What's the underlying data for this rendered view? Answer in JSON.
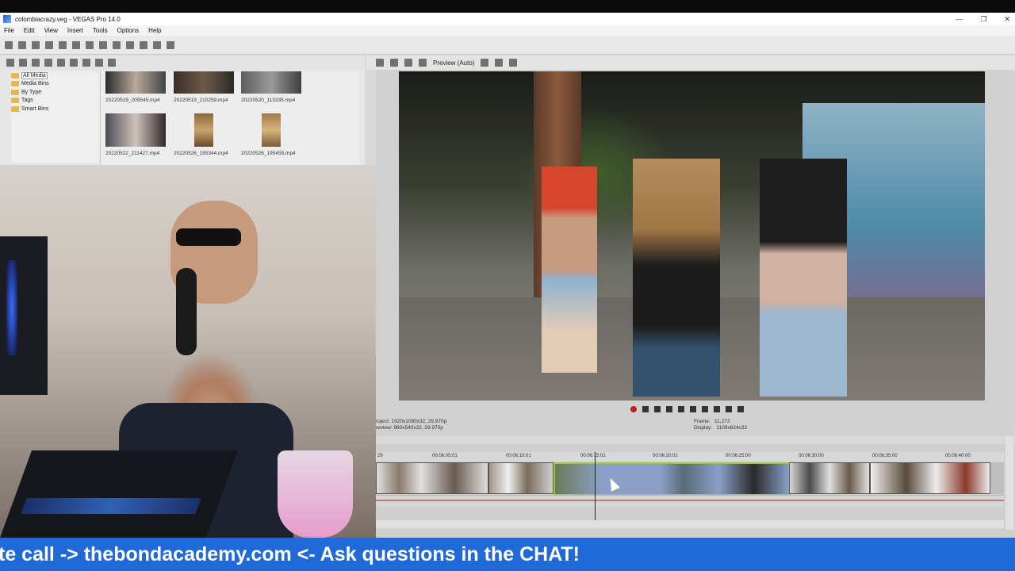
{
  "window": {
    "title": "colombiacrazy.veg - VEGAS Pro 14.0",
    "controls": [
      "—",
      "❐",
      "✕"
    ]
  },
  "menu": [
    "File",
    "Edit",
    "View",
    "Insert",
    "Tools",
    "Options",
    "Help"
  ],
  "explorer": {
    "tree": [
      {
        "label": "All Media",
        "selected": true
      },
      {
        "label": "Media Bins"
      },
      {
        "label": "By Type"
      },
      {
        "label": "Tags"
      },
      {
        "label": "Smart Bins"
      }
    ],
    "media": [
      "20220519_205545.mp4",
      "20220519_210259.mp4",
      "20220520_113335.mp4",
      "20220522_211427.mp4",
      "20220526_195344.mp4",
      "20220526_195455.mp4"
    ]
  },
  "preview": {
    "mode": "Preview (Auto)",
    "project": "roject:   1920x1080x32, 29.970p",
    "preview_res": "review:   960x540x32, 29.970p",
    "frame_label": "Frame:",
    "frame_value": "11,273",
    "display_label": "Display:",
    "display_value": "1109x624x32"
  },
  "timeline": {
    "ticks": [
      "29",
      "00:06:05:01",
      "00:06:10:01",
      "00:06:15:01",
      "00:06:20:01",
      "00:06:25:00",
      "00:06:30:00",
      "00:06:35:00",
      "00:06:40:00"
    ]
  },
  "banner": {
    "text": "te call -> thebondacademy.com <- Ask questions in the CHAT!"
  },
  "colors": {
    "banner": "#1f6ad6",
    "accent_clip": "#9acd32"
  }
}
